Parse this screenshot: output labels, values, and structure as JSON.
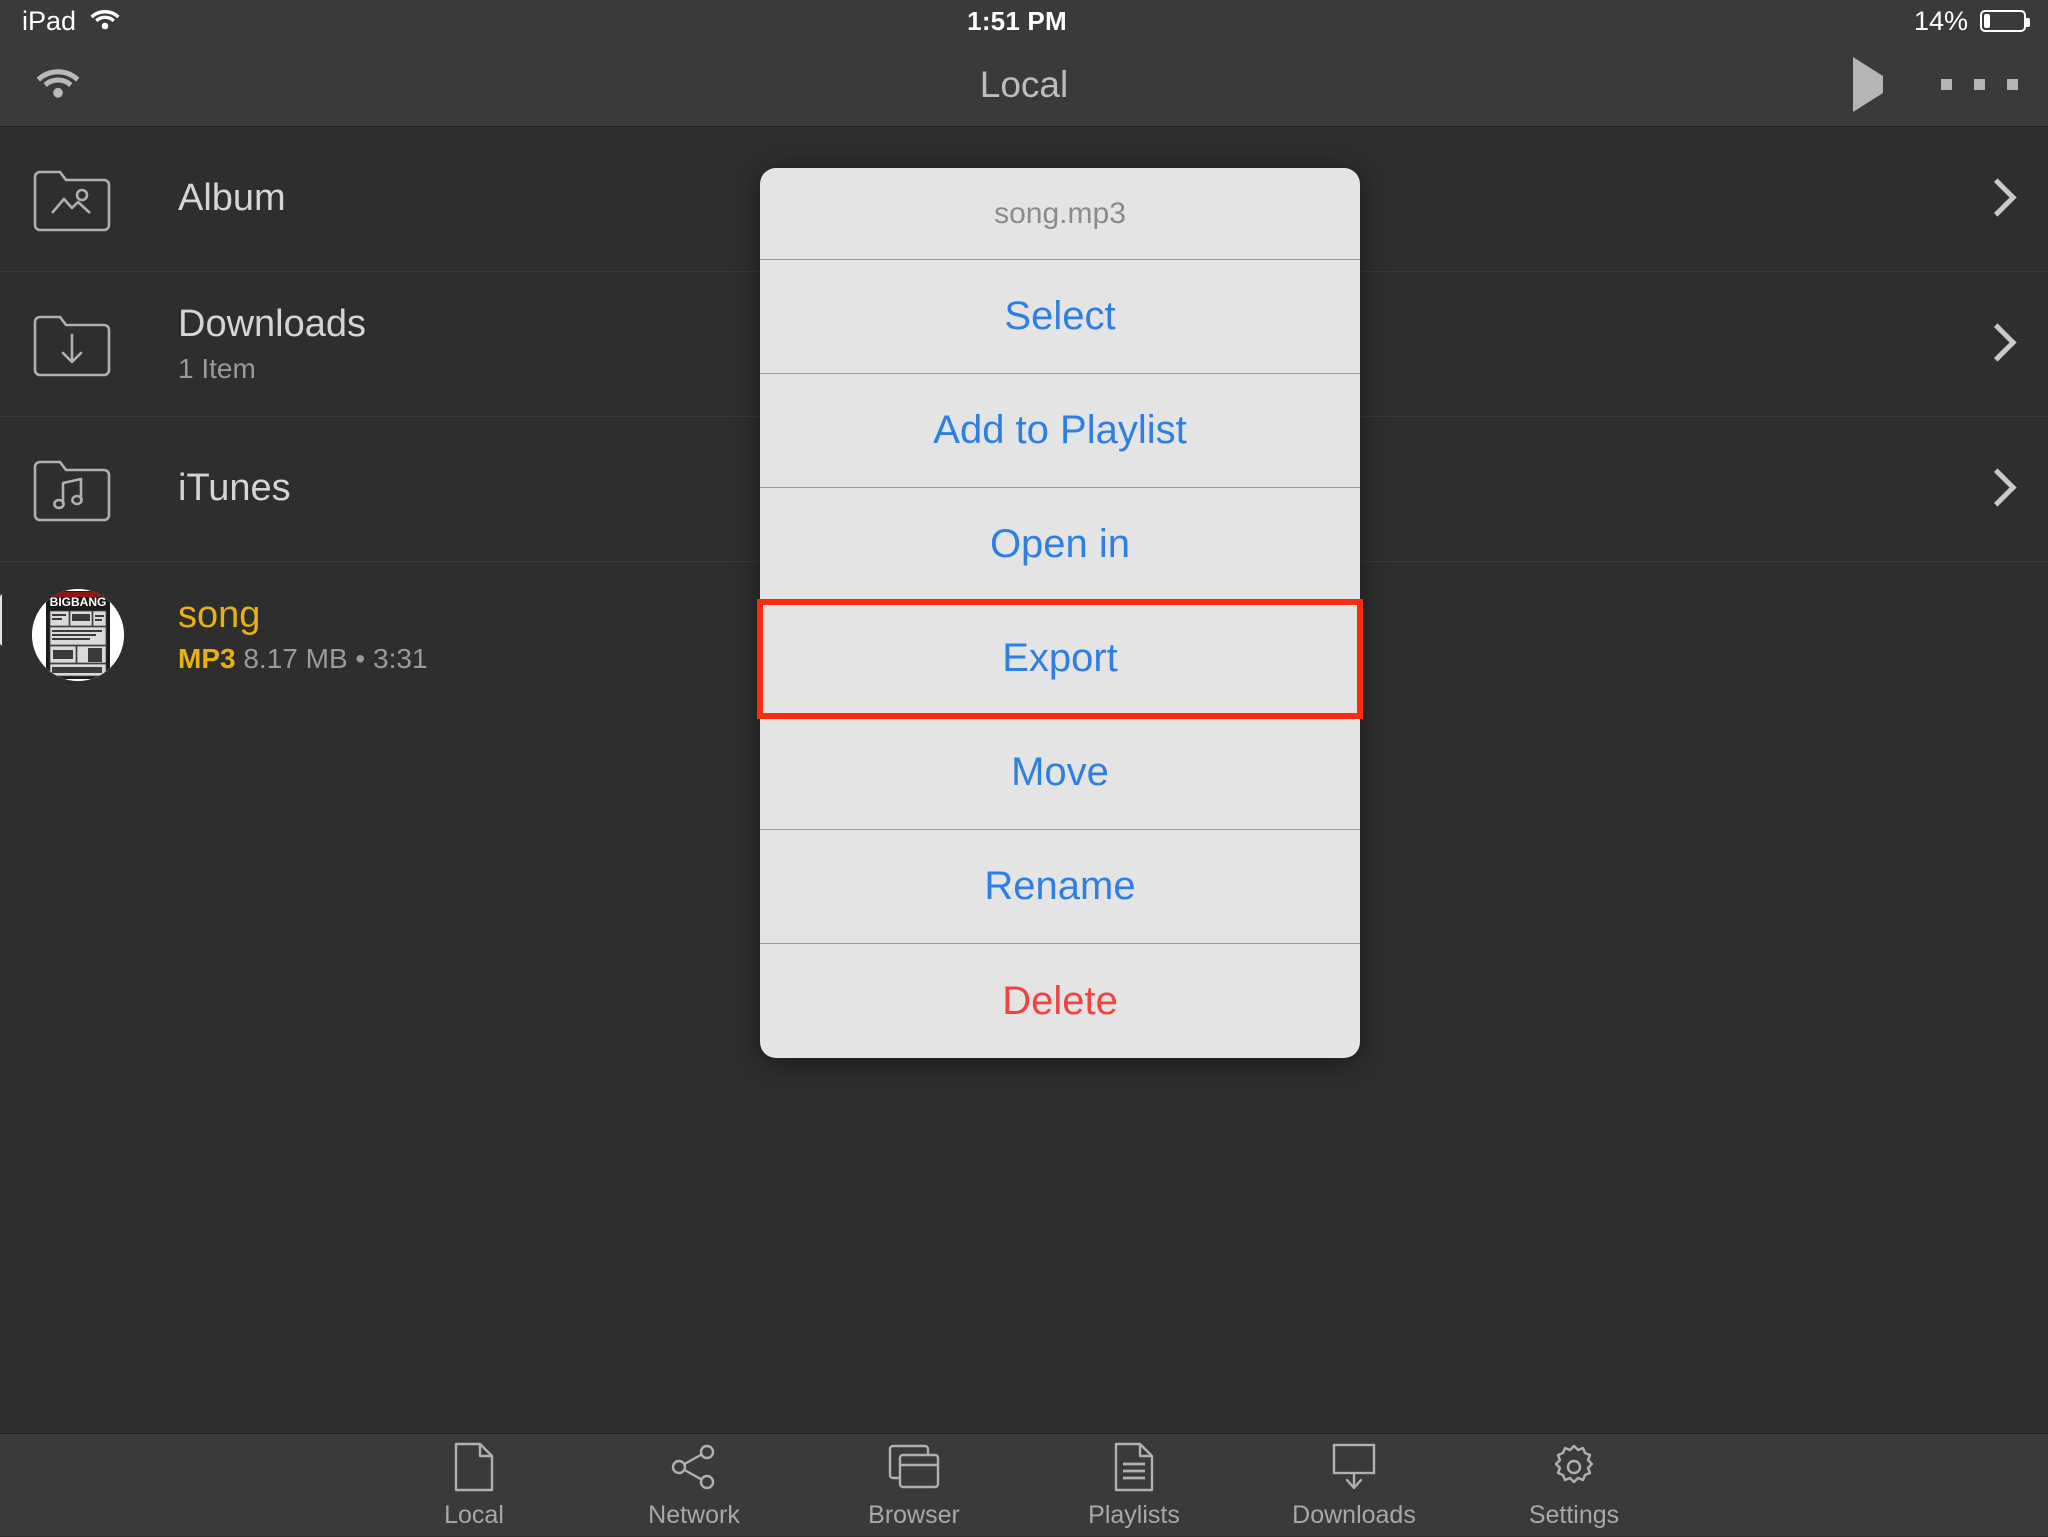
{
  "status_bar": {
    "device": "iPad",
    "wifi_icon": "wifi-icon",
    "time": "1:51 PM",
    "battery_percent": "14%",
    "battery_icon": "battery-low-icon"
  },
  "nav_bar": {
    "left_icon": "wifi-icon",
    "title": "Local",
    "play_icon": "play-icon",
    "more_icon": "ellipsis-icon"
  },
  "file_list": {
    "rows": [
      {
        "name": "Album",
        "subtitle": "",
        "icon": "folder-photos-icon",
        "accessory": "chevron-right-icon",
        "highlighted": false
      },
      {
        "name": "Downloads",
        "subtitle": "1 Item",
        "icon": "folder-downloads-icon",
        "accessory": "chevron-right-icon",
        "highlighted": false
      },
      {
        "name": "iTunes",
        "subtitle": "",
        "icon": "folder-music-icon",
        "accessory": "chevron-right-icon",
        "highlighted": false
      }
    ],
    "song": {
      "name": "song",
      "format": "MP3",
      "size": "8.17 MB",
      "separator": "•",
      "duration": "3:31",
      "artwork_label": "BIGBANG",
      "artwork_icon": "album-artwork-thumbnail"
    }
  },
  "popover": {
    "header": "song.mp3",
    "items": [
      {
        "label": "Select",
        "style": "default",
        "focused": false
      },
      {
        "label": "Add to Playlist",
        "style": "default",
        "focused": false
      },
      {
        "label": "Open in",
        "style": "default",
        "focused": false
      },
      {
        "label": "Export",
        "style": "default",
        "focused": true
      },
      {
        "label": "Move",
        "style": "default",
        "focused": false
      },
      {
        "label": "Rename",
        "style": "default",
        "focused": false
      },
      {
        "label": "Delete",
        "style": "destructive",
        "focused": false
      }
    ],
    "highlight_color": "#fb2b10",
    "action_color": "#2d7fe3",
    "destructive_color": "#f0453f"
  },
  "tab_bar": {
    "tabs": [
      {
        "label": "Local",
        "icon": "document-icon",
        "active": true
      },
      {
        "label": "Network",
        "icon": "share-nodes-icon",
        "active": false
      },
      {
        "label": "Browser",
        "icon": "windows-icon",
        "active": false
      },
      {
        "label": "Playlists",
        "icon": "document-lines-icon",
        "active": false
      },
      {
        "label": "Downloads",
        "icon": "download-tray-icon",
        "active": false
      },
      {
        "label": "Settings",
        "icon": "gear-icon",
        "active": false
      }
    ]
  },
  "colors": {
    "background": "#2e2e2e",
    "chrome": "#3a3a3a",
    "accent_yellow": "#e8b013",
    "popover_bg": "#e4e4e4"
  }
}
